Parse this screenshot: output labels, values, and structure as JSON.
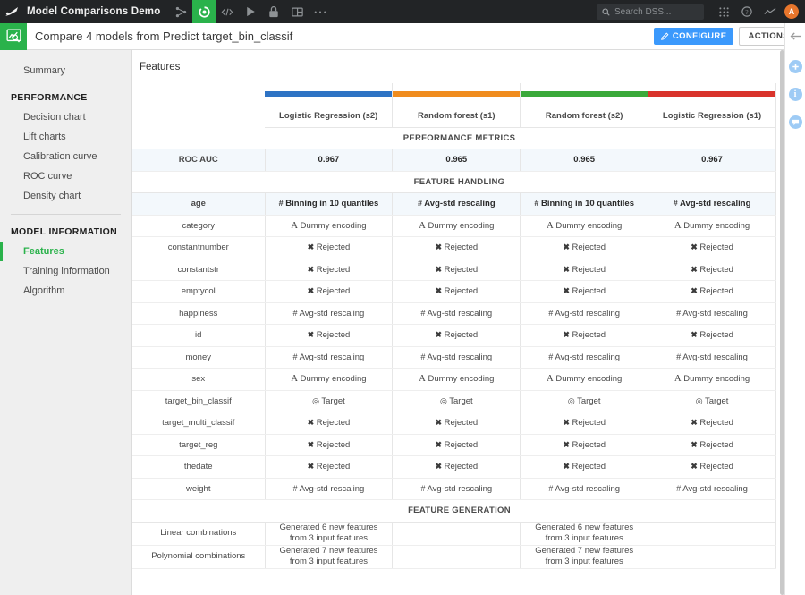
{
  "topbar": {
    "logo_icon": "dataiku-logo-icon",
    "project_name": "Model Comparisons Demo",
    "nav_icons": [
      {
        "name": "flow-icon",
        "label": "Flow"
      },
      {
        "name": "lab-icon",
        "label": "Lab",
        "active": true
      },
      {
        "name": "code-icon",
        "label": "Code"
      },
      {
        "name": "run-icon",
        "label": "Run"
      },
      {
        "name": "jobs-icon",
        "label": "Jobs"
      },
      {
        "name": "dashboard-icon",
        "label": "Dashboards"
      },
      {
        "name": "more-icon",
        "label": "More"
      }
    ],
    "search_placeholder": "Search DSS...",
    "apps_icon": "apps-grid-icon",
    "help_icon": "help-icon",
    "activity_icon": "activity-chart-icon",
    "avatar_initial": "A"
  },
  "subbar": {
    "model_icon": "model-comparison-icon",
    "title": "Compare 4 models from Predict target_bin_classif",
    "configure_label": "CONFIGURE",
    "configure_icon": "edit-pencil-icon",
    "actions_label": "ACTIONS",
    "collapse_icon": "arrow-left-icon",
    "accent_blue": "#3b99fc",
    "accent_green": "#2ab24b"
  },
  "sidebar": {
    "items": [
      {
        "label": "Summary",
        "type": "link",
        "selected": false
      },
      {
        "label": "PERFORMANCE",
        "type": "heading"
      },
      {
        "label": "Decision chart",
        "type": "link",
        "selected": false
      },
      {
        "label": "Lift charts",
        "type": "link",
        "selected": false
      },
      {
        "label": "Calibration curve",
        "type": "link",
        "selected": false
      },
      {
        "label": "ROC curve",
        "type": "link",
        "selected": false
      },
      {
        "label": "Density chart",
        "type": "link",
        "selected": false
      },
      {
        "label": "MODEL INFORMATION",
        "type": "heading"
      },
      {
        "label": "Features",
        "type": "link",
        "selected": true
      },
      {
        "label": "Training information",
        "type": "link",
        "selected": false
      },
      {
        "label": "Algorithm",
        "type": "link",
        "selected": false
      }
    ]
  },
  "main": {
    "panel_title": "Features",
    "columns": [
      {
        "label": "Logistic Regression (s2)",
        "color": "#2e73c4"
      },
      {
        "label": "Random forest (s1)",
        "color": "#f08c1e"
      },
      {
        "label": "Random forest (s2)",
        "color": "#3aa93a"
      },
      {
        "label": "Logistic Regression (s1)",
        "color": "#d9332b"
      }
    ],
    "sections": [
      {
        "title": "PERFORMANCE METRICS",
        "rows": [
          {
            "label": "ROC AUC",
            "highlight": true,
            "tall": false,
            "values": [
              "0.967",
              "0.965",
              "0.965",
              "0.967"
            ],
            "icons": [
              "",
              "",
              "",
              ""
            ]
          }
        ]
      },
      {
        "title": "FEATURE HANDLING",
        "rows": [
          {
            "label": "age",
            "highlight": true,
            "tall": false,
            "values": [
              "Binning in 10 quantiles",
              "Avg-std rescaling",
              "Binning in 10 quantiles",
              "Avg-std rescaling"
            ],
            "icons": [
              "hash",
              "hash",
              "hash",
              "hash"
            ]
          },
          {
            "label": "category",
            "highlight": false,
            "tall": false,
            "values": [
              "Dummy encoding",
              "Dummy encoding",
              "Dummy encoding",
              "Dummy encoding"
            ],
            "icons": [
              "letterA",
              "letterA",
              "letterA",
              "letterA"
            ]
          },
          {
            "label": "constantnumber",
            "highlight": false,
            "tall": false,
            "values": [
              "Rejected",
              "Rejected",
              "Rejected",
              "Rejected"
            ],
            "icons": [
              "cross",
              "cross",
              "cross",
              "cross"
            ]
          },
          {
            "label": "constantstr",
            "highlight": false,
            "tall": false,
            "values": [
              "Rejected",
              "Rejected",
              "Rejected",
              "Rejected"
            ],
            "icons": [
              "cross",
              "cross",
              "cross",
              "cross"
            ]
          },
          {
            "label": "emptycol",
            "highlight": false,
            "tall": false,
            "values": [
              "Rejected",
              "Rejected",
              "Rejected",
              "Rejected"
            ],
            "icons": [
              "cross",
              "cross",
              "cross",
              "cross"
            ]
          },
          {
            "label": "happiness",
            "highlight": false,
            "tall": false,
            "values": [
              "Avg-std rescaling",
              "Avg-std rescaling",
              "Avg-std rescaling",
              "Avg-std rescaling"
            ],
            "icons": [
              "hash",
              "hash",
              "hash",
              "hash"
            ]
          },
          {
            "label": "id",
            "highlight": false,
            "tall": false,
            "values": [
              "Rejected",
              "Rejected",
              "Rejected",
              "Rejected"
            ],
            "icons": [
              "cross",
              "cross",
              "cross",
              "cross"
            ]
          },
          {
            "label": "money",
            "highlight": false,
            "tall": false,
            "values": [
              "Avg-std rescaling",
              "Avg-std rescaling",
              "Avg-std rescaling",
              "Avg-std rescaling"
            ],
            "icons": [
              "hash",
              "hash",
              "hash",
              "hash"
            ]
          },
          {
            "label": "sex",
            "highlight": false,
            "tall": false,
            "values": [
              "Dummy encoding",
              "Dummy encoding",
              "Dummy encoding",
              "Dummy encoding"
            ],
            "icons": [
              "letterA",
              "letterA",
              "letterA",
              "letterA"
            ]
          },
          {
            "label": "target_bin_classif",
            "highlight": false,
            "tall": false,
            "values": [
              "Target",
              "Target",
              "Target",
              "Target"
            ],
            "icons": [
              "bullseye",
              "bullseye",
              "bullseye",
              "bullseye"
            ]
          },
          {
            "label": "target_multi_classif",
            "highlight": false,
            "tall": false,
            "values": [
              "Rejected",
              "Rejected",
              "Rejected",
              "Rejected"
            ],
            "icons": [
              "cross",
              "cross",
              "cross",
              "cross"
            ]
          },
          {
            "label": "target_reg",
            "highlight": false,
            "tall": false,
            "values": [
              "Rejected",
              "Rejected",
              "Rejected",
              "Rejected"
            ],
            "icons": [
              "cross",
              "cross",
              "cross",
              "cross"
            ]
          },
          {
            "label": "thedate",
            "highlight": false,
            "tall": false,
            "values": [
              "Rejected",
              "Rejected",
              "Rejected",
              "Rejected"
            ],
            "icons": [
              "cross",
              "cross",
              "cross",
              "cross"
            ]
          },
          {
            "label": "weight",
            "highlight": false,
            "tall": false,
            "values": [
              "Avg-std rescaling",
              "Avg-std rescaling",
              "Avg-std rescaling",
              "Avg-std rescaling"
            ],
            "icons": [
              "hash",
              "hash",
              "hash",
              "hash"
            ]
          }
        ]
      },
      {
        "title": "FEATURE GENERATION",
        "rows": [
          {
            "label": "Linear combinations",
            "highlight": false,
            "tall": true,
            "values": [
              "Generated 6 new features from 3 input features",
              "",
              "Generated 6 new features from 3 input features",
              ""
            ],
            "icons": [
              "",
              "",
              "",
              ""
            ]
          },
          {
            "label": "Polynomial combinations",
            "highlight": false,
            "tall": true,
            "values": [
              "Generated 7 new features from 3 input features",
              "",
              "Generated 7 new features from 3 input features",
              ""
            ],
            "icons": [
              "",
              "",
              "",
              ""
            ]
          }
        ]
      }
    ]
  },
  "rail": {
    "icons": [
      {
        "name": "arrow-left-icon",
        "glyph": ""
      },
      {
        "name": "add-circle-icon",
        "glyph": "+"
      },
      {
        "name": "info-circle-icon",
        "glyph": "i"
      },
      {
        "name": "comment-circle-icon",
        "glyph": ""
      }
    ]
  }
}
